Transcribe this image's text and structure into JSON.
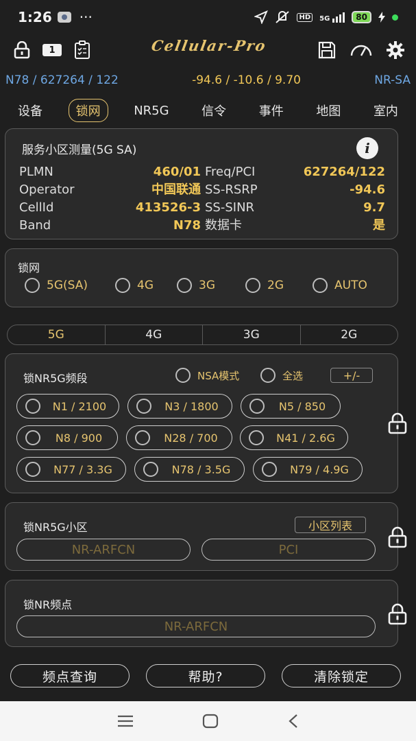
{
  "status_bar": {
    "time": "1:26",
    "more": "···",
    "network": "5G",
    "hd": "HD",
    "battery": "80"
  },
  "toolbar": {
    "logo": "Cellular-Pro",
    "sim_badge": "1"
  },
  "info_bar": {
    "cell": "N78 / 627264 / 122",
    "signal": "-94.6 / -10.6 / 9.70",
    "mode": "NR-SA"
  },
  "tabs": [
    {
      "label": "设备",
      "active": false
    },
    {
      "label": "锁网",
      "active": true
    },
    {
      "label": "NR5G",
      "active": false
    },
    {
      "label": "信令",
      "active": false
    },
    {
      "label": "事件",
      "active": false
    },
    {
      "label": "地图",
      "active": false
    },
    {
      "label": "室内",
      "active": false
    }
  ],
  "measurement": {
    "title": "服务小区测量(5G SA)",
    "rows": [
      {
        "k1": "PLMN",
        "v1": "460/01",
        "k2": "Freq/PCI",
        "v2": "627264/122"
      },
      {
        "k1": "Operator",
        "v1": "中国联通",
        "k2": "SS-RSRP",
        "v2": "-94.6"
      },
      {
        "k1": "CellId",
        "v1": "413526-3",
        "k2": "SS-SINR",
        "v2": "9.7"
      },
      {
        "k1": "Band",
        "v1": "N78",
        "k2": "数据卡",
        "v2": "是"
      }
    ]
  },
  "lock_network": {
    "title": "锁网",
    "options": [
      "5G(SA)",
      "4G",
      "3G",
      "2G",
      "AUTO"
    ]
  },
  "rat_segments": [
    {
      "label": "5G",
      "active": true
    },
    {
      "label": "4G",
      "active": false
    },
    {
      "label": "3G",
      "active": false
    },
    {
      "label": "2G",
      "active": false
    }
  ],
  "nr5g_bands": {
    "title": "锁NR5G频段",
    "nsa_label": "NSA模式",
    "select_all_label": "全选",
    "toggle_label": "+/-",
    "bands": [
      "N1 / 2100",
      "N3 / 1800",
      "N5 / 850",
      "N8 / 900",
      "N28 / 700",
      "N41 / 2.6G",
      "N77 / 3.3G",
      "N78 / 3.5G",
      "N79 / 4.9G"
    ]
  },
  "nr5g_cell": {
    "title": "锁NR5G小区",
    "cell_list_label": "小区列表",
    "arfcn_placeholder": "NR-ARFCN",
    "pci_placeholder": "PCI"
  },
  "nr_freq": {
    "title": "锁NR频点",
    "arfcn_placeholder": "NR-ARFCN"
  },
  "bottom_buttons": {
    "query": "频点查询",
    "help": "帮助?",
    "clear": "清除锁定"
  },
  "colors": {
    "accent": "#e6c46f",
    "value_yellow": "#f1c757",
    "info_blue": "#6ea7e3",
    "background": "#1f1f1f",
    "card": "#2a2a2a"
  }
}
